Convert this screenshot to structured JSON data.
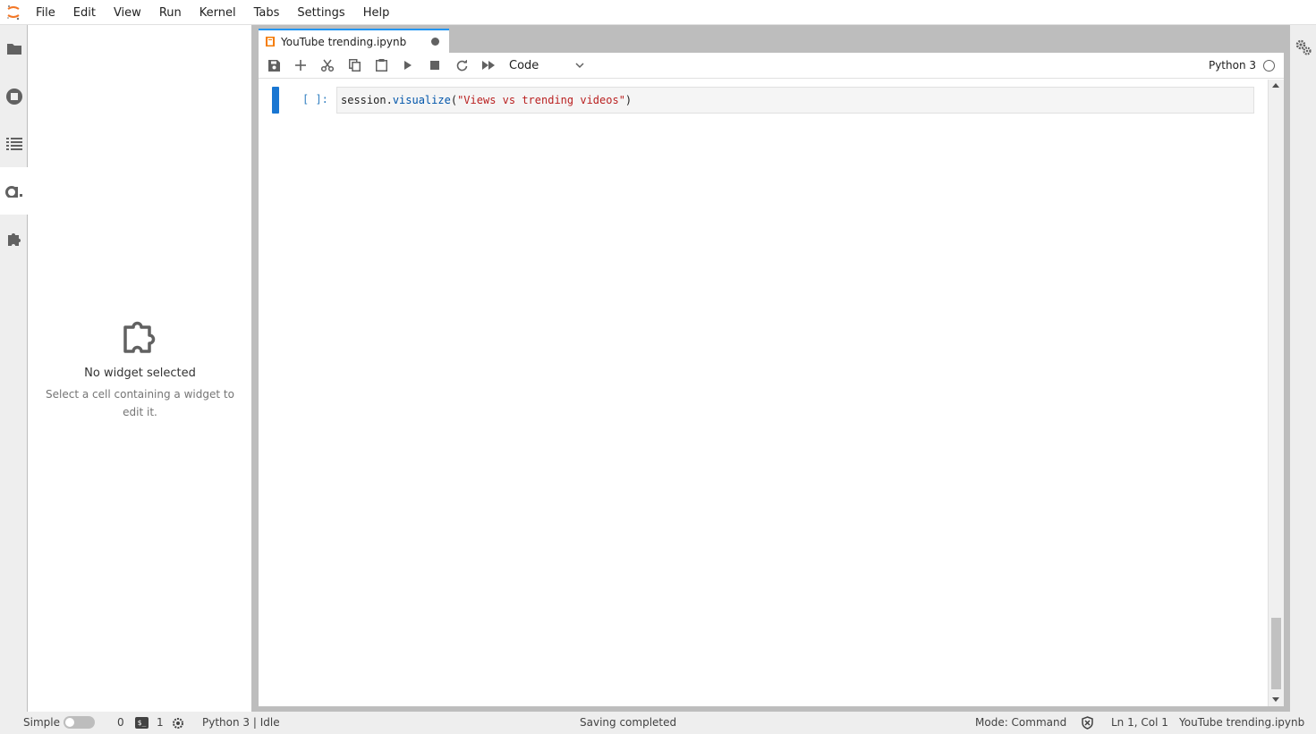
{
  "menubar": {
    "items": [
      "File",
      "Edit",
      "View",
      "Run",
      "Kernel",
      "Tabs",
      "Settings",
      "Help"
    ]
  },
  "activity_bar": {
    "left_icons": [
      "folder-icon",
      "running-icon",
      "toc-icon",
      "property-inspector-icon",
      "extension-icon"
    ],
    "right_icons": [
      "property-inspector-gears-icon"
    ]
  },
  "widget_panel": {
    "title": "No widget selected",
    "description": "Select a cell containing a widget to edit it."
  },
  "document_tab": {
    "label": "YouTube trending.ipynb",
    "dirty": true
  },
  "toolbar": {
    "buttons": [
      "save-icon",
      "add-cell-icon",
      "cut-icon",
      "copy-icon",
      "paste-icon",
      "run-icon",
      "stop-icon",
      "restart-icon",
      "fast-forward-icon"
    ],
    "cell_type": "Code",
    "kernel_name": "Python 3"
  },
  "cell": {
    "prompt": "[ ]:",
    "code": {
      "object": "session",
      "dot": ".",
      "method": "visualize",
      "open_paren": "(",
      "string": "\"Views vs trending videos\"",
      "close_paren": ")"
    }
  },
  "statusbar": {
    "mode_label": "Simple",
    "kernels_count": "0",
    "terminals_count": "1",
    "kernel_status": "Python 3 | Idle",
    "message": "Saving completed",
    "mode": "Mode: Command",
    "position": "Ln 1, Col 1",
    "filename": "YouTube trending.ipynb"
  },
  "colors": {
    "accent": "#2196f3",
    "active_cell": "#1976d2",
    "prompt": "#307fc1",
    "string": "#ba2121",
    "property": "#0055aa"
  }
}
